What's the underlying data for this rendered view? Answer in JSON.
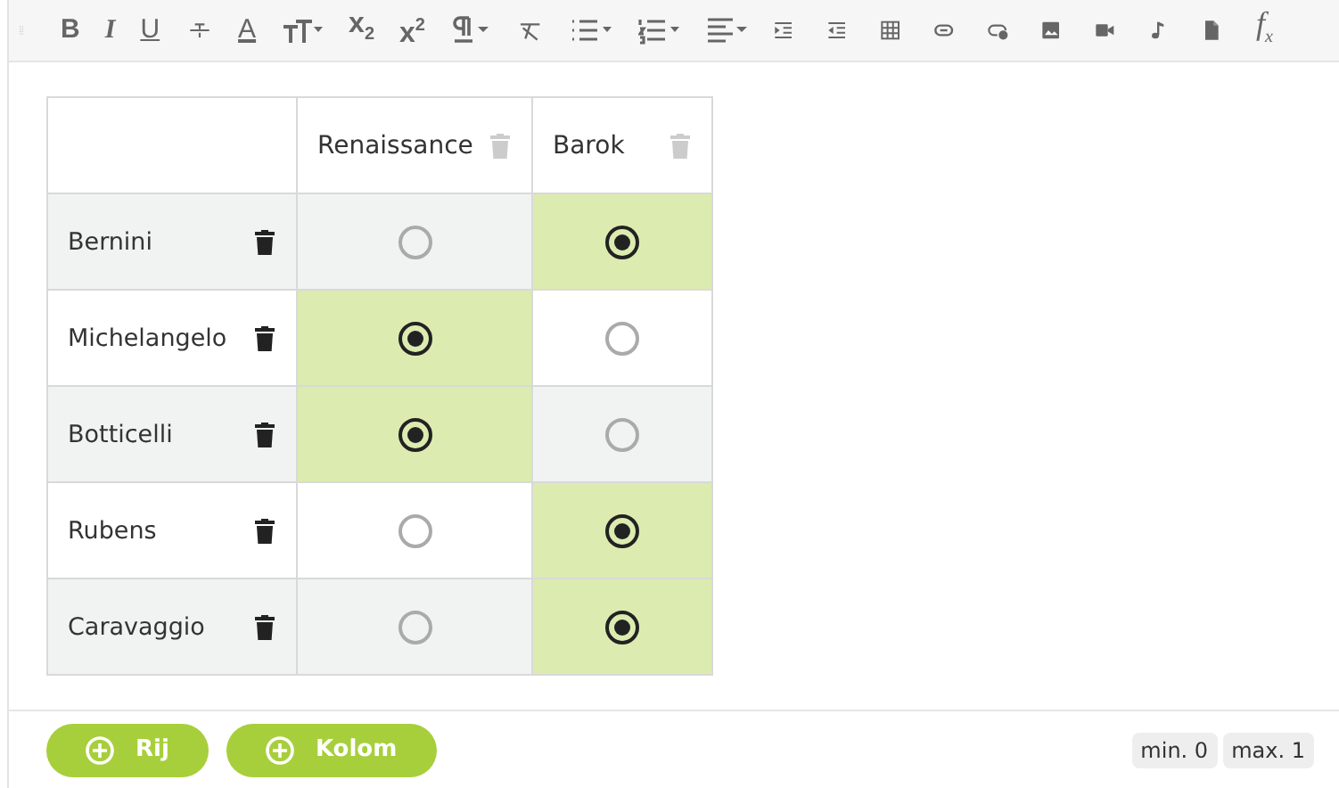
{
  "toolbar": [
    {
      "kind": "grip"
    },
    {
      "kind": "bold",
      "label": "B"
    },
    {
      "kind": "italic",
      "label": "I"
    },
    {
      "kind": "underline",
      "label": "U"
    },
    {
      "kind": "strike"
    },
    {
      "kind": "color",
      "label": "A"
    },
    {
      "kind": "size"
    },
    {
      "kind": "sub",
      "label": "x",
      "index": "2"
    },
    {
      "kind": "sup",
      "label": "x",
      "index": "2"
    },
    {
      "kind": "para"
    },
    {
      "kind": "clear"
    },
    {
      "kind": "bullets"
    },
    {
      "kind": "numbers"
    },
    {
      "kind": "align"
    },
    {
      "kind": "indent"
    },
    {
      "kind": "outdent"
    },
    {
      "kind": "table"
    },
    {
      "kind": "link"
    },
    {
      "kind": "linkadd"
    },
    {
      "kind": "image"
    },
    {
      "kind": "video"
    },
    {
      "kind": "music"
    },
    {
      "kind": "file"
    },
    {
      "kind": "fx",
      "label": "f",
      "index": "x"
    }
  ],
  "columns": [
    "Renaissance",
    "Barok"
  ],
  "rows": [
    {
      "name": "Bernini",
      "cells": [
        {
          "selected": false
        },
        {
          "selected": true
        }
      ]
    },
    {
      "name": "Michelangelo",
      "cells": [
        {
          "selected": true
        },
        {
          "selected": false
        }
      ]
    },
    {
      "name": "Botticelli",
      "cells": [
        {
          "selected": true
        },
        {
          "selected": false
        }
      ]
    },
    {
      "name": "Rubens",
      "cells": [
        {
          "selected": false
        },
        {
          "selected": true
        }
      ]
    },
    {
      "name": "Caravaggio",
      "cells": [
        {
          "selected": false
        },
        {
          "selected": true
        }
      ]
    }
  ],
  "buttons": [
    "Rij",
    "Kolom"
  ],
  "limits": [
    "min. 0",
    "max. 1"
  ]
}
